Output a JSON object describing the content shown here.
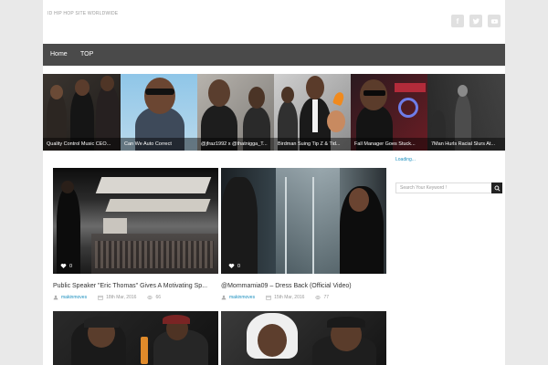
{
  "header": {
    "site_title": "ID HIP HOP SITE WORLDWIDE"
  },
  "social": {
    "facebook": "f",
    "twitter": "twitter-bird-icon",
    "youtube": "youtube-play-icon"
  },
  "nav": {
    "items": [
      "Home",
      "TOP"
    ]
  },
  "slider": {
    "slides": [
      {
        "caption": "Quality Control Music CEO..."
      },
      {
        "caption": "Can We Auto Correct"
      },
      {
        "caption": "@jfraz1992 x @thatnigga_T..."
      },
      {
        "caption": "Birdman Suing Tip Z & Tid..."
      },
      {
        "caption": "Fall Manager Goes Stuck..."
      },
      {
        "caption": "7Man Hurls Racial Slurs At..."
      }
    ]
  },
  "sidebar": {
    "loading": "Loading...",
    "search_placeholder": "Search Your Keyword !"
  },
  "posts": [
    {
      "title": "Public Speaker \"Eric Thomas\" Gives A Motivating Sp...",
      "author": "makinmoves",
      "date": "18th Mar, 2016",
      "views": "66",
      "likes": "0"
    },
    {
      "title": "@Mommamia09 – Dress Back (Official Video)",
      "author": "makinmoves",
      "date": "15th Mar, 2016",
      "views": "77",
      "likes": "0"
    },
    {
      "title": "",
      "author": "",
      "date": "",
      "views": "",
      "likes": ""
    },
    {
      "title": "",
      "author": "",
      "date": "",
      "views": "",
      "likes": ""
    }
  ],
  "colors": {
    "nav_bg": "#4a4a4a",
    "link": "#1a8fbf",
    "page_bg": "#e9e9e9"
  }
}
